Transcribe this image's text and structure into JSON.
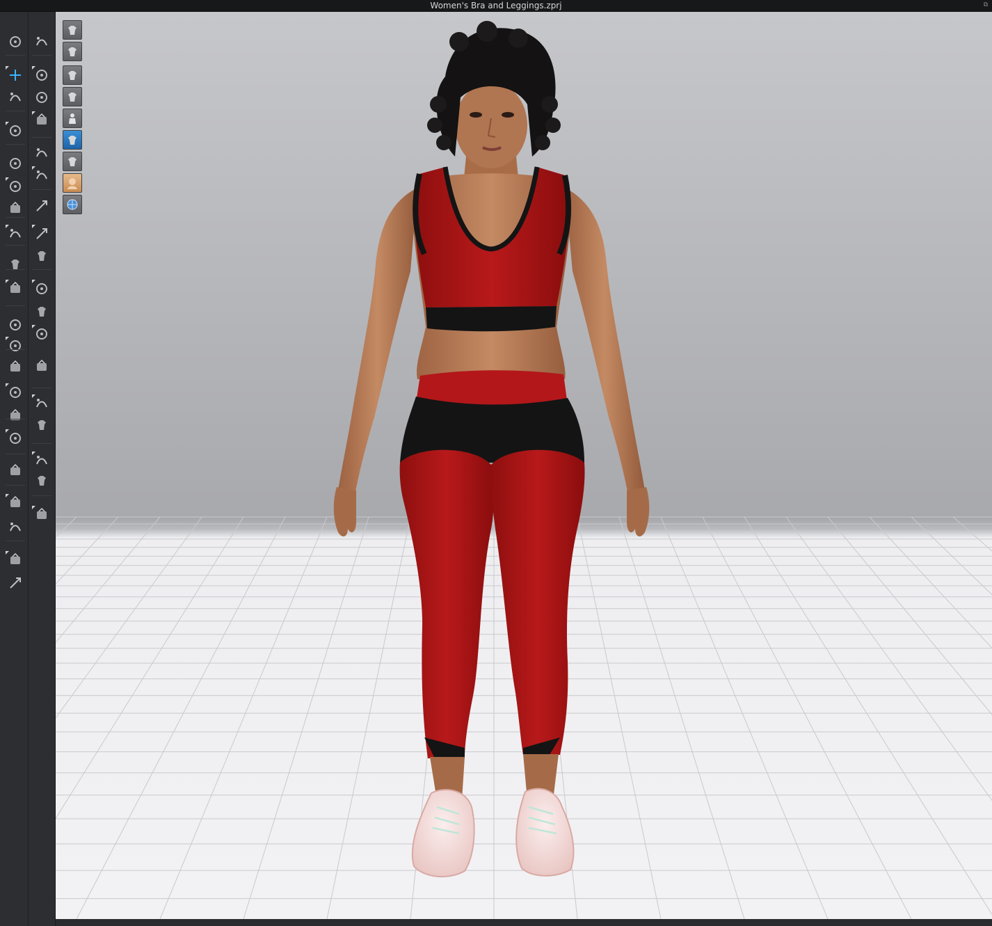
{
  "window": {
    "title": "Women's Bra and Leggings.zprj"
  },
  "colors": {
    "accent": "#3bb5ff",
    "garment_red": "#b01515",
    "garment_black": "#141414",
    "skin": "#b97a55",
    "toolbar_bg": "#2d2e31"
  },
  "toolbar": {
    "left_column": [
      "simulation-icon",
      "transform-pattern-icon",
      "select-mesh-icon",
      "garment-fit-icon",
      "sewing-icon",
      "segment-sewing-icon",
      "free-sewing-icon",
      "tack-icon",
      "pin-icon",
      "needle-icon",
      "fold-arrangement-icon",
      "avatar-measure-icon",
      "symmetry-icon",
      "unfold-icon",
      "arrangement-point-icon",
      "avatar-pose-icon",
      "pattern-flatten-icon",
      "tape-icon",
      "ruler-icon",
      "layer-icon",
      "strengthen-icon"
    ],
    "right_column": [
      "walking-icon",
      "brush-icon",
      "puckering-icon",
      "shrinkage-icon",
      "line-icon",
      "measure-icon",
      "fabric-icon",
      "texture-icon",
      "fitting-icon",
      "button-icon",
      "buttonhole-icon",
      "lock-button-icon",
      "zipper-icon",
      "box-icon",
      "box-large-icon",
      "shape-icon",
      "shape-large-icon",
      "split-icon"
    ]
  },
  "viewport_controls": [
    "render-view-icon",
    "shirt-view-icon",
    "garment-visible-icon",
    "texture-visible-icon",
    "avatar-visible-icon",
    "hair-visible-icon",
    "shoes-visible-icon",
    "face-visible-icon",
    "grid-visible-icon"
  ]
}
